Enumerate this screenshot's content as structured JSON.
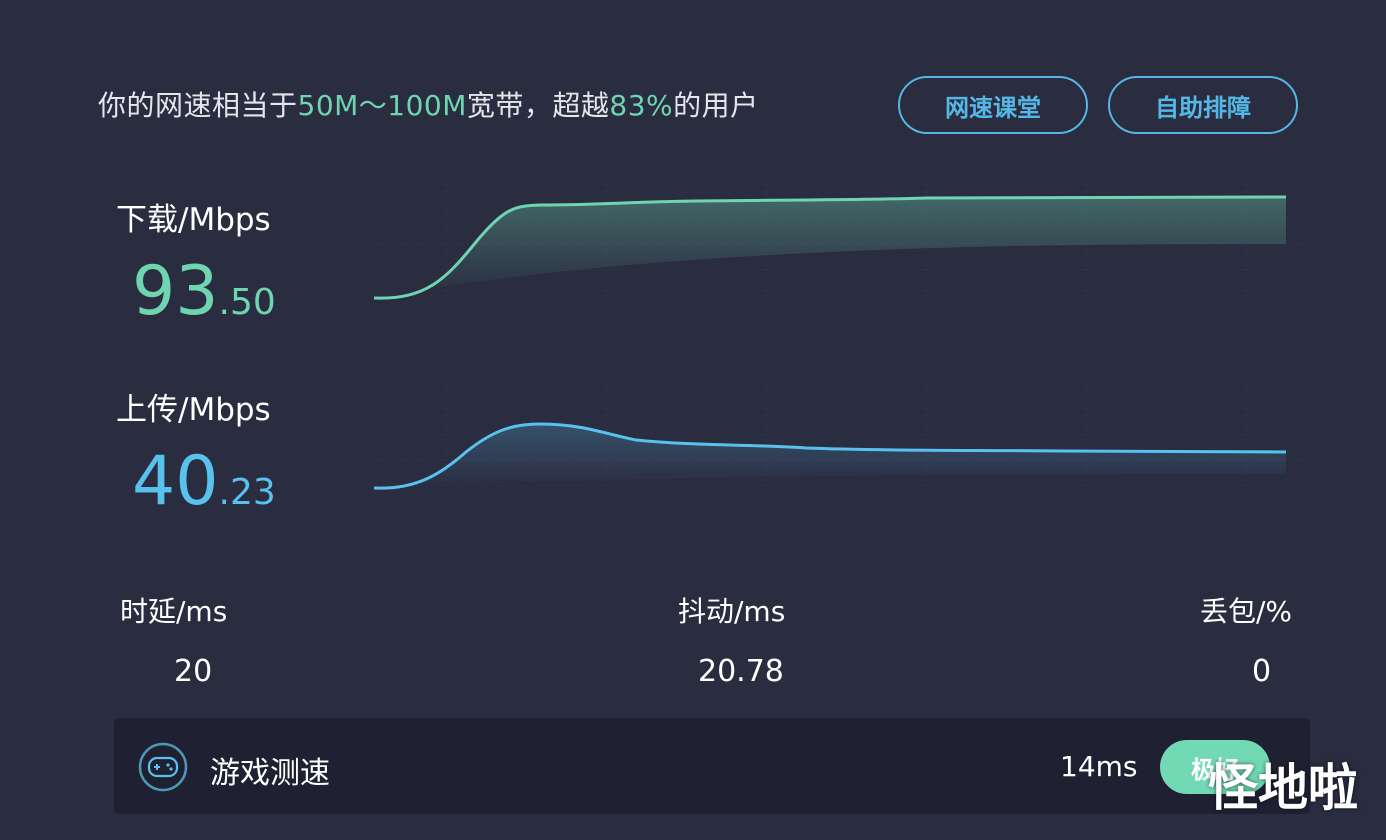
{
  "summary": {
    "part1": "你的网速相当于",
    "range": "50M～100M",
    "part2": "宽带，超越",
    "percent": "83%",
    "part3": "的用户"
  },
  "buttons": {
    "speed_class": "网速课堂",
    "self_help": "自助排障"
  },
  "download": {
    "label": "下载/Mbps",
    "int": "93",
    "dec": ".50",
    "color": "#6fd4b0"
  },
  "upload": {
    "label": "上传/Mbps",
    "int": "40",
    "dec": ".23",
    "color": "#58c1ee"
  },
  "stats": {
    "latency": {
      "label": "时延/ms",
      "value": "20"
    },
    "jitter": {
      "label": "抖动/ms",
      "value": "20.78"
    },
    "loss": {
      "label": "丢包/%",
      "value": "0"
    }
  },
  "game": {
    "icon": "gamepad-icon",
    "label": "游戏测速",
    "ms": "14ms",
    "badge": "极好"
  },
  "watermark": "怪地啦"
}
